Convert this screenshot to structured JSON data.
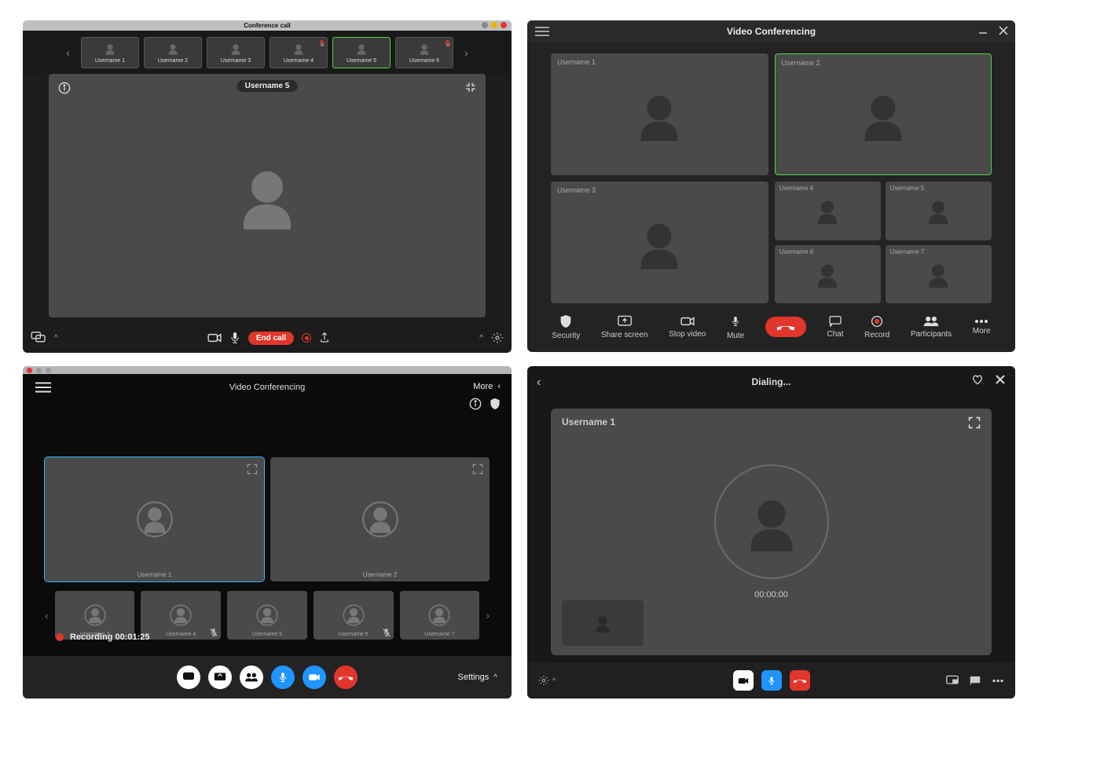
{
  "panelA": {
    "title": "Conference call",
    "thumbs": [
      "Username 1",
      "Username 2",
      "Username 3",
      "Username 4",
      "Username 5",
      "Username 6"
    ],
    "active_thumb_index": 4,
    "muted_thumb_indices": [
      3,
      5
    ],
    "stage_label": "Username 5",
    "end_call_label": "End call"
  },
  "panelB": {
    "title": "Video Conferencing",
    "big_tiles": [
      "Username 1",
      "Username 2",
      "Username 3"
    ],
    "selected_big_index": 1,
    "small_tiles": [
      "Username 4",
      "Username 5",
      "Username 6",
      "Username 7"
    ],
    "toolbar": {
      "security": "Security",
      "share": "Share screen",
      "stopvideo": "Stop video",
      "mute": "Mute",
      "chat": "Chat",
      "record": "Record",
      "participants": "Participants",
      "more": "More"
    }
  },
  "panelC": {
    "title": "Video Conferencing",
    "more_label": "More",
    "big_tiles": [
      "Username 1",
      "Username 2"
    ],
    "selected_big_index": 0,
    "strip": [
      "Username 3",
      "Username 4",
      "Username 5",
      "Username 6",
      "Username 7"
    ],
    "strip_muted_indices": [
      1,
      3
    ],
    "recording_label": "Recording 00:01:25",
    "settings_label": "Settings"
  },
  "panelD": {
    "title": "Dialing...",
    "username": "Username 1",
    "timer": "00:00:00"
  }
}
